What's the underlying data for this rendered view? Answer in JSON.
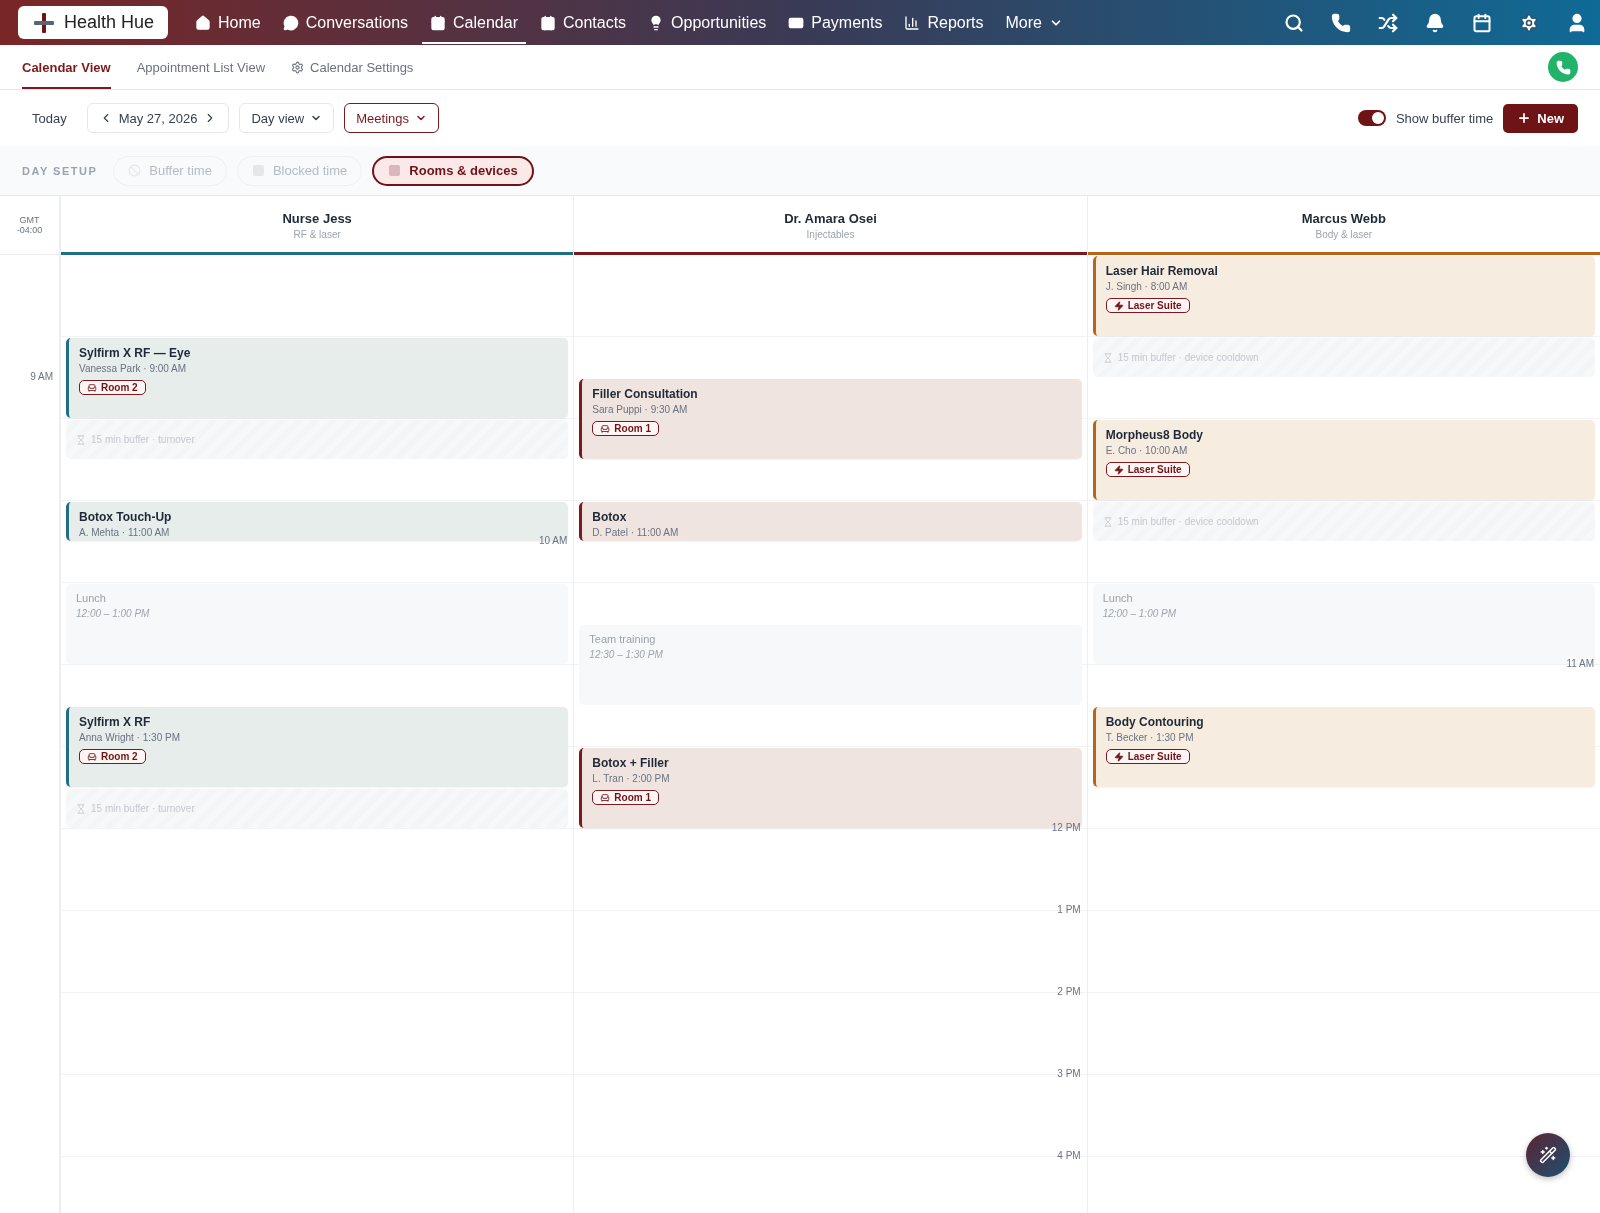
{
  "nav": {
    "brand": "Health Hue",
    "items": [
      {
        "label": "Home",
        "selected": false
      },
      {
        "label": "Conversations",
        "selected": false
      },
      {
        "label": "Calendar",
        "selected": true
      },
      {
        "label": "Contacts",
        "selected": false
      },
      {
        "label": "Opportunities",
        "selected": false
      },
      {
        "label": "Payments",
        "selected": false
      },
      {
        "label": "Reports",
        "selected": false
      },
      {
        "label": "More",
        "selected": false
      }
    ]
  },
  "subtabs": [
    {
      "label": "Calendar View",
      "selected": true
    },
    {
      "label": "Appointment List View",
      "selected": false
    },
    {
      "label": "Calendar Settings",
      "selected": false
    }
  ],
  "toolbar": {
    "today": "Today",
    "date": "May 27, 2026",
    "view": "Day view",
    "filter": "Meetings",
    "buffer_toggle": {
      "label": "Show buffer time",
      "on": true
    },
    "new_button": "New"
  },
  "day_setup": {
    "label": "DAY SETUP",
    "chips": [
      {
        "label": "Buffer time",
        "on": false
      },
      {
        "label": "Blocked time",
        "on": false
      },
      {
        "label": "Rooms & devices",
        "on": true
      }
    ]
  },
  "timezone": [
    "GMT",
    "-04:00"
  ],
  "time_labels": [
    "9 AM",
    "10 AM",
    "11 AM",
    "12 PM",
    "1 PM",
    "2 PM",
    "3 PM",
    "4 PM"
  ],
  "columns": [
    {
      "name": "Nurse Jess",
      "role": "RF & laser",
      "color": "#1f6e85",
      "events": [
        {
          "kind": "appointment",
          "title": "Sylfirm X RF — Eye",
          "detail": "Vanessa Park · 9:00 AM",
          "badge": {
            "kind": "room",
            "label": "Room 2"
          }
        },
        {
          "kind": "buffer",
          "text": "15 min buffer · turnover"
        },
        {
          "kind": "appointment",
          "title": "Botox Touch-Up",
          "detail": "A. Mehta · 11:00 AM"
        },
        {
          "kind": "blocked",
          "title": "Lunch",
          "time": "12:00 – 1:00 PM"
        },
        {
          "kind": "appointment",
          "title": "Sylfirm X RF",
          "detail": "Anna Wright · 1:30 PM",
          "badge": {
            "kind": "room",
            "label": "Room 2"
          }
        },
        {
          "kind": "buffer",
          "text": "15 min buffer · turnover"
        }
      ]
    },
    {
      "name": "Dr. Amara Osei",
      "role": "Injectables",
      "color": "#7a1a1e",
      "events": [
        {
          "kind": "appointment",
          "title": "Filler Consultation",
          "detail": "Sara Puppi · 9:30 AM",
          "badge": {
            "kind": "room",
            "label": "Room 1"
          }
        },
        {
          "kind": "appointment",
          "title": "Botox",
          "detail": "D. Patel · 11:00 AM"
        },
        {
          "kind": "blocked",
          "title": "Team training",
          "time": "12:30 – 1:30 PM"
        },
        {
          "kind": "appointment",
          "title": "Botox + Filler",
          "detail": "L. Tran · 2:00 PM",
          "badge": {
            "kind": "room",
            "label": "Room 1"
          }
        }
      ]
    },
    {
      "name": "Marcus Webb",
      "role": "Body & laser",
      "color": "#b8651b",
      "events": [
        {
          "kind": "appointment",
          "title": "Laser Hair Removal",
          "detail": "J. Singh · 8:00 AM",
          "badge": {
            "kind": "device",
            "label": "Laser Suite"
          }
        },
        {
          "kind": "buffer",
          "text": "15 min buffer · device cooldown"
        },
        {
          "kind": "appointment",
          "title": "Morpheus8 Body",
          "detail": "E. Cho · 10:00 AM",
          "badge": {
            "kind": "device",
            "label": "Laser Suite"
          }
        },
        {
          "kind": "buffer",
          "text": "15 min buffer · device cooldown"
        },
        {
          "kind": "blocked",
          "title": "Lunch",
          "time": "12:00 – 1:00 PM"
        },
        {
          "kind": "appointment",
          "title": "Body Contouring",
          "detail": "T. Becker · 1:30 PM",
          "badge": {
            "kind": "device",
            "label": "Laser Suite"
          }
        }
      ]
    }
  ]
}
